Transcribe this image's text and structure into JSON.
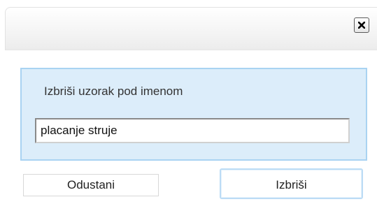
{
  "dialog": {
    "close_icon": "close-icon",
    "prompt": "Izbriši uzorak pod imenom",
    "name_value": "placanje struje",
    "cancel_label": "Odustani",
    "delete_label": "Izbriši"
  },
  "colors": {
    "panel_background": "#dcedfa",
    "panel_border": "#a9d3f2",
    "focused_button_border": "#bcdcf5"
  }
}
